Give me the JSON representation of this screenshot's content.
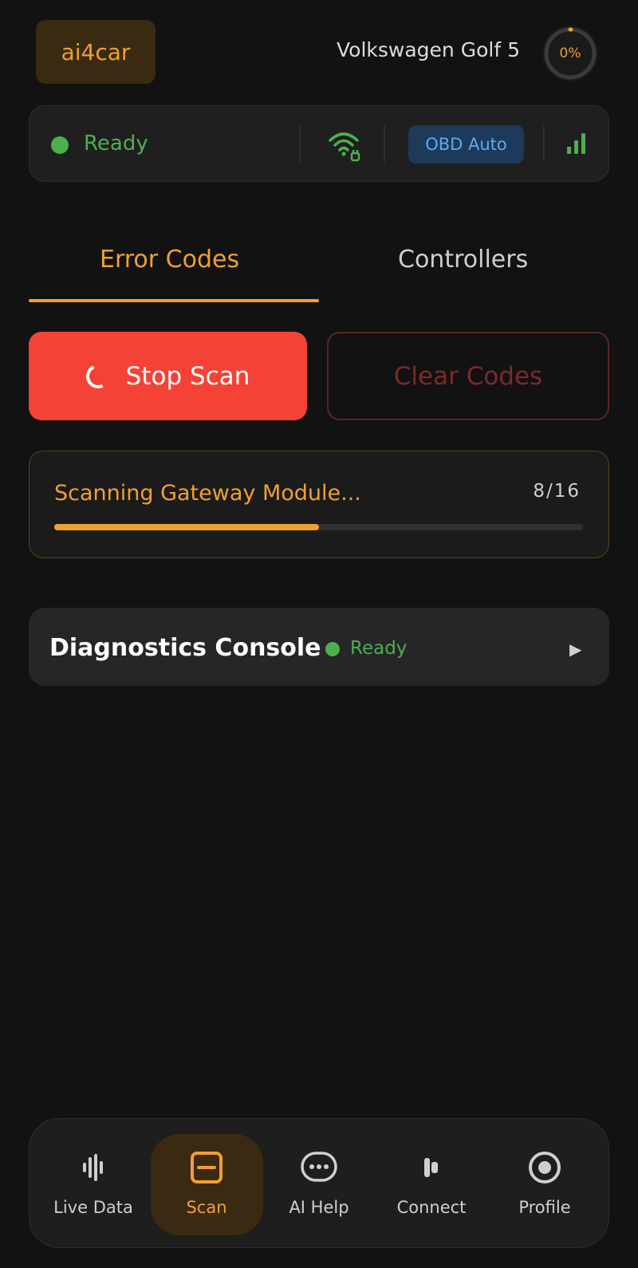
{
  "header": {
    "logo_text": "ai4car",
    "vehicle": "Volkswagen Golf 5",
    "progress_label": "0%",
    "progress_fraction": 0.0
  },
  "status_bar": {
    "status_text": "Ready",
    "status_color": "#4caf50",
    "connection_icon": "wifi-plug-icon",
    "mode_badge": "OBD Auto",
    "signal_icon": "signal-bars-icon"
  },
  "tabs": [
    {
      "label": "Error Codes",
      "active": true
    },
    {
      "label": "Controllers",
      "active": false
    }
  ],
  "actions": {
    "stop_label": "Stop Scan",
    "clear_label": "Clear Codes"
  },
  "scan": {
    "label": "Scanning Gateway Module...",
    "count": "8/16",
    "progress_fraction": 0.5
  },
  "console": {
    "title": "Diagnostics Console",
    "status": "Ready"
  },
  "nav": [
    {
      "label": "Live Data",
      "icon": "waveform-icon",
      "active": false
    },
    {
      "label": "Scan",
      "icon": "scan-icon",
      "active": true
    },
    {
      "label": "AI Help",
      "icon": "chat-bubble-icon",
      "active": false
    },
    {
      "label": "Connect",
      "icon": "connect-icon",
      "active": false
    },
    {
      "label": "Profile",
      "icon": "profile-icon",
      "active": false
    }
  ],
  "colors": {
    "accent": "#f0a030",
    "danger": "#f44336",
    "success": "#4caf50",
    "info": "#5ea8ef",
    "background": "#121212"
  }
}
